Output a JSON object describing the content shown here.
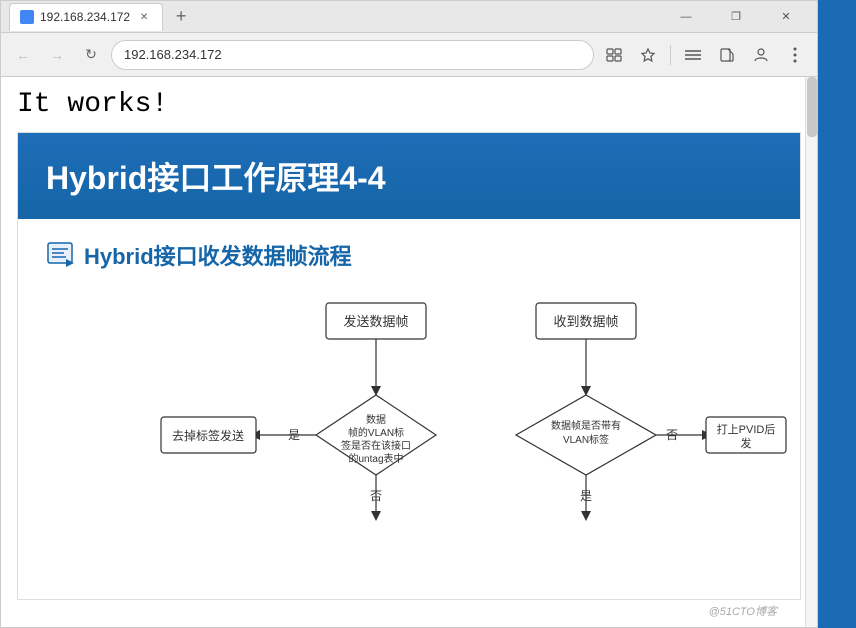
{
  "browser": {
    "tab_label": "192.168.234.172",
    "new_tab_symbol": "+",
    "address": "192.168.234.172",
    "minimize_label": "—",
    "restore_label": "❐",
    "close_label": "✕",
    "back_symbol": "←",
    "forward_symbol": "→",
    "refresh_symbol": "↻",
    "menu_symbol": "≡",
    "read_symbol": "📖",
    "star_symbol": "☆",
    "share_symbol": "⬡",
    "person_symbol": "👤",
    "more_symbol": "···"
  },
  "page": {
    "it_works_text": "It works!",
    "slide": {
      "title": "Hybrid接口工作原理4-4",
      "section_title": "Hybrid接口收发数据帧流程",
      "flowchart": {
        "node_send": "发送数据帧",
        "node_receive": "收到数据帧",
        "diamond_send_label": "数据\n帧的VLAN标\n签是否在该接口\n的untag表中",
        "diamond_receive_label": "数据帧是否带有\nVLAN标签",
        "action_remove": "去掉标签发送",
        "action_pvid": "打上PVID后发",
        "yes_label_1": "是",
        "no_label_1": "否",
        "yes_label_2": "是",
        "no_label_2": "否"
      }
    }
  },
  "watermark": "@51CTO博客"
}
